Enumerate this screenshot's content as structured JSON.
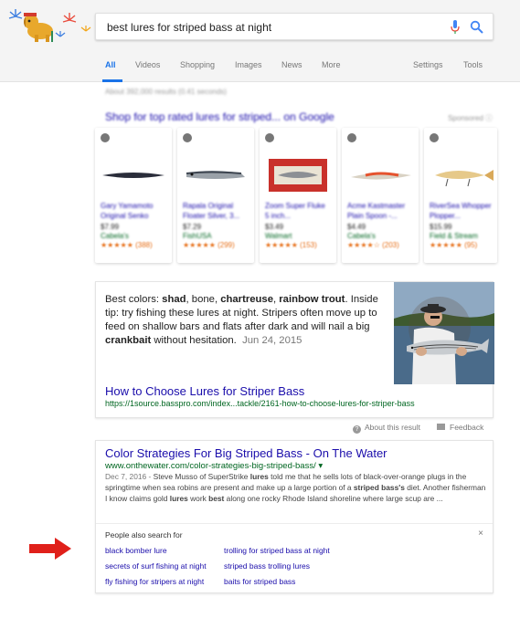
{
  "search": {
    "query": "best lures for striped bass at night"
  },
  "tabs": [
    "All",
    "Videos",
    "Shopping",
    "Images",
    "News",
    "More",
    "Settings",
    "Tools"
  ],
  "stats_text": "About 392,000 results (0.41 seconds)",
  "shopping": {
    "title": "Shop for top rated lures for striped... on Google",
    "sponsored": "Sponsored ⓘ",
    "products": [
      {
        "title": "Gary Yamamoto Original Senko",
        "price": "$7.99",
        "store": "Cabela's",
        "stars": "★★★★★ (388)"
      },
      {
        "title": "Rapala Original Floater Silver, 3...",
        "price": "$7.29",
        "store": "FishUSA",
        "stars": "★★★★★ (299)"
      },
      {
        "title": "Zoom Super Fluke 5 inch...",
        "price": "$3.49",
        "store": "Walmart",
        "stars": "★★★★★ (153)"
      },
      {
        "title": "Acme Kastmaster Plain Spoon -...",
        "price": "$4.49",
        "store": "Cabela's",
        "stars": "★★★★☆ (203)"
      },
      {
        "title": "RiverSea Whopper Plopper...",
        "price": "$15.99",
        "store": "Field & Stream",
        "stars": "★★★★★ (95)"
      }
    ]
  },
  "featured_snippet": {
    "t1": "Best colors: ",
    "b1": "shad",
    "t2": ", bone, ",
    "b2": "chartreuse",
    "t3": ", ",
    "b3": "rainbow trout",
    "t4": ". Inside tip: try fishing these lures at night. Stripers often move up to feed on shallow bars and flats after dark and will nail a big ",
    "b4": "crankbait",
    "t5": " without hesitation.",
    "date": "Jun 24, 2015",
    "link": "How to Choose Lures for Striper Bass",
    "url": "https://1source.basspro.com/index...tackle/2161-how-to-choose-lures-for-striper-bass"
  },
  "about_row": {
    "about": "About this result",
    "feedback": "Feedback"
  },
  "result": {
    "title": "Color Strategies For Big Striped Bass - On The Water",
    "url": "www.onthewater.com/color-strategies-big-striped-bass/ ▾",
    "date": "Dec 7, 2016 - ",
    "s1": "Steve Musso of SuperStrike ",
    "b1": "lures",
    "s2": " told me that he sells lots of black-over-orange plugs in the springtime when sea robins are present and make up a large portion of a ",
    "b2": "striped bass's",
    "s3": " diet. Another fisherman I know claims gold ",
    "b3": "lures",
    "s4": " work ",
    "b4": "best",
    "s5": " along one rocky Rhode Island shoreline where large scup are ..."
  },
  "people_also_search": {
    "title": "People also search for",
    "close": "×",
    "links": [
      "black bomber lure",
      "trolling for striped bass at night",
      "secrets of surf fishing at night",
      "striped bass trolling lures",
      "fly fishing for stripers at night",
      "baits for striped bass"
    ]
  },
  "colors": {
    "link": "#1a0dab",
    "url_green": "#006621",
    "tab_active": "#1a73e8",
    "arrow_red": "#e0201a"
  }
}
